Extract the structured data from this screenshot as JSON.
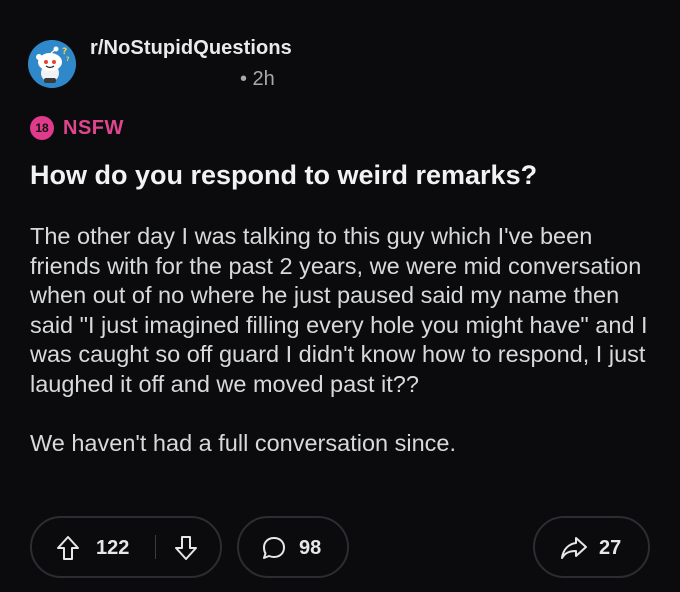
{
  "post": {
    "subreddit": "r/NoStupidQuestions",
    "time": "• 2h",
    "nsfw_badge": "18",
    "nsfw_label": "NSFW",
    "title": "How do you respond to weird remarks?",
    "body_paragraphs": [
      "The other day I was talking to this guy which I've been friends with for the past 2 years, we were mid conversation when out of no where he just paused said my name then said \"I just imagined filling every hole you might have\" and I was caught so off guard I didn't know how to respond, I just laughed it off and we moved past it??",
      "We haven't had a full conversation since."
    ]
  },
  "actions": {
    "upvotes": "122",
    "comments": "98",
    "shares": "27"
  },
  "icons": {
    "avatar": "snoo-avatar-icon",
    "upvote": "arrow-up-icon",
    "downvote": "arrow-down-icon",
    "comment": "speech-bubble-icon",
    "share": "share-arrow-icon"
  },
  "colors": {
    "background": "#0b0b0d",
    "nsfw": "#e03a8c",
    "text": "#d7dadc"
  }
}
